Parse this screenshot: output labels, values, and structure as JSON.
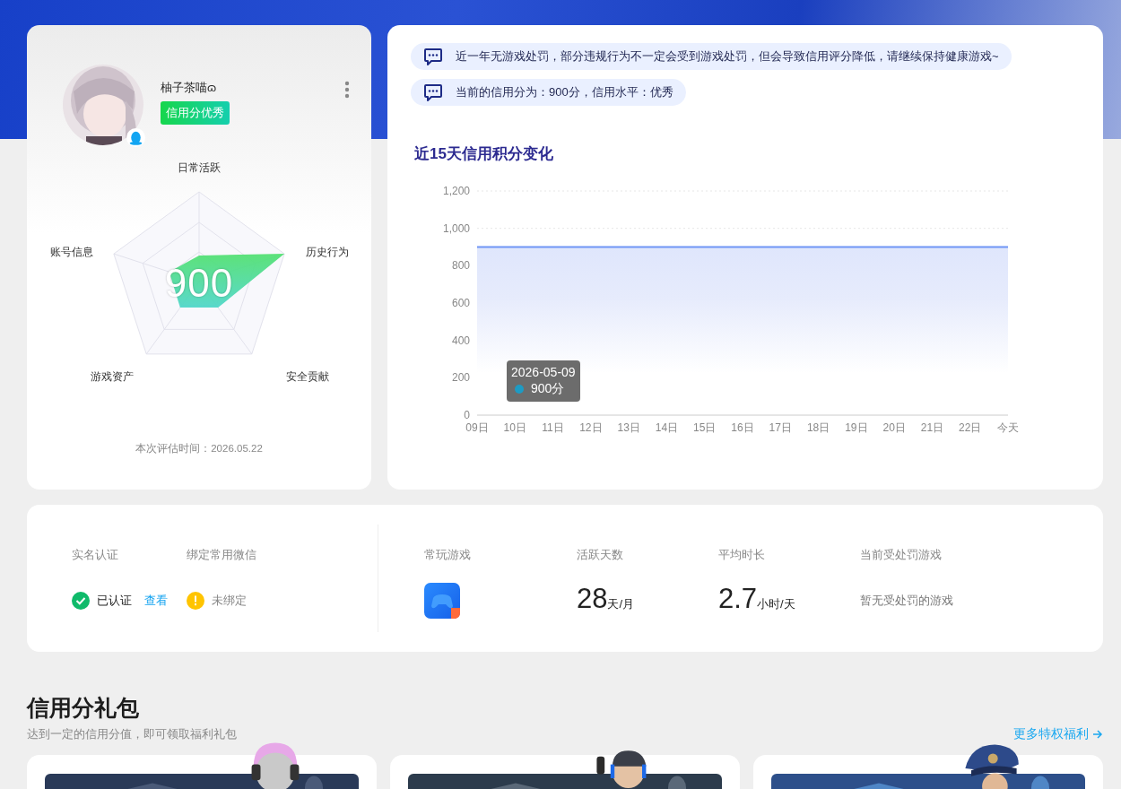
{
  "profile": {
    "name": "柚子茶喵ɷ",
    "badge": "信用分优秀",
    "score": "900",
    "radar_axes": [
      "日常活跃",
      "历史行为",
      "安全贡献",
      "游戏资产",
      "账号信息"
    ],
    "evaluated": "本次评估时间：2026.05.22"
  },
  "notices": [
    "近一年无游戏处罚，部分违规行为不一定会受到游戏处罚，但会导致信用评分降低，请继续保持健康游戏~",
    "当前的信用分为：900分，信用水平：优秀"
  ],
  "trend": {
    "title": "近15天信用积分变化",
    "chart_data": {
      "type": "area",
      "categories": [
        "09日",
        "10日",
        "11日",
        "12日",
        "13日",
        "14日",
        "15日",
        "16日",
        "17日",
        "18日",
        "19日",
        "20日",
        "21日",
        "22日",
        "今天"
      ],
      "series": [
        {
          "color": "#6f95f5",
          "values": [
            900,
            900,
            900,
            900,
            900,
            900,
            900,
            900,
            900,
            900,
            900,
            900,
            900,
            900,
            900
          ]
        }
      ],
      "ylim": [
        0,
        1200
      ],
      "yticks": [
        0,
        200,
        400,
        600,
        800,
        {
          "value": 1000,
          "label": "1,000"
        },
        {
          "value": 1200,
          "label": "1,200"
        }
      ]
    },
    "tooltip": {
      "date": "2026-05-09",
      "value": "900分"
    }
  },
  "stats": {
    "verify": {
      "label": "实名认证",
      "status": "已认证",
      "verified": true,
      "link": "查看"
    },
    "wechat": {
      "label": "绑定常用微信",
      "status": "未绑定",
      "bound": false
    },
    "games": {
      "label": "常玩游戏"
    },
    "active": {
      "label": "活跃天数",
      "value": "28",
      "unit": "天/月"
    },
    "duration": {
      "label": "平均时长",
      "value": "2.7",
      "unit": "小时/天"
    },
    "penalty": {
      "label": "当前受处罚游戏",
      "text": "暂无受处罚的游戏"
    }
  },
  "gifts": {
    "title": "信用分礼包",
    "subtitle": "达到一定的信用分值，即可领取福利礼包",
    "more": "更多特权福利"
  }
}
